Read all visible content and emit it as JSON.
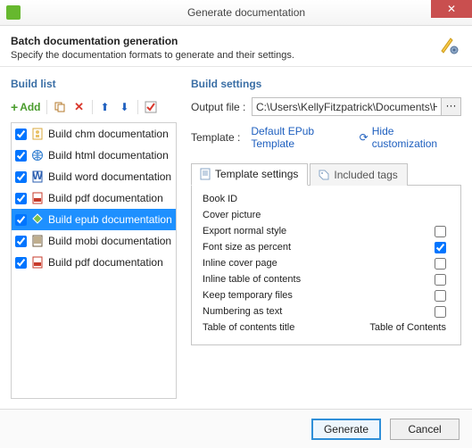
{
  "titlebar": {
    "title": "Generate documentation",
    "close_glyph": "✕"
  },
  "header": {
    "title": "Batch documentation generation",
    "subtitle": "Specify the documentation formats to generate and their settings."
  },
  "left": {
    "section": "Build list",
    "toolbar": {
      "add": "Add"
    },
    "items": [
      {
        "label": "Build chm documentation",
        "checked": true,
        "icon": "chm",
        "selected": false
      },
      {
        "label": "Build html documentation",
        "checked": true,
        "icon": "html",
        "selected": false
      },
      {
        "label": "Build word documentation",
        "checked": true,
        "icon": "word",
        "selected": false
      },
      {
        "label": "Build pdf documentation",
        "checked": true,
        "icon": "pdf",
        "selected": false
      },
      {
        "label": "Build epub documentation",
        "checked": true,
        "icon": "epub",
        "selected": true
      },
      {
        "label": "Build mobi documentation",
        "checked": true,
        "icon": "mobi",
        "selected": false
      },
      {
        "label": "Build pdf documentation",
        "checked": true,
        "icon": "pdf",
        "selected": false
      }
    ]
  },
  "right": {
    "section": "Build settings",
    "output_label": "Output file :",
    "output_value": "C:\\Users\\KellyFitzpatrick\\Documents\\HelpND",
    "template_label": "Template :",
    "template_value": "Default EPub Template",
    "hide_customization": "Hide customization",
    "tabs": {
      "template": "Template settings",
      "included": "Included tags"
    },
    "settings": [
      {
        "label": "Book ID",
        "checkbox": false,
        "checked": false,
        "value": ""
      },
      {
        "label": "Cover picture",
        "checkbox": false,
        "checked": false,
        "value": ""
      },
      {
        "label": "Export normal style",
        "checkbox": true,
        "checked": false,
        "value": ""
      },
      {
        "label": "Font size as percent",
        "checkbox": true,
        "checked": true,
        "value": ""
      },
      {
        "label": "Inline cover page",
        "checkbox": true,
        "checked": false,
        "value": ""
      },
      {
        "label": "Inline table of contents",
        "checkbox": true,
        "checked": false,
        "value": ""
      },
      {
        "label": "Keep temporary files",
        "checkbox": true,
        "checked": false,
        "value": ""
      },
      {
        "label": "Numbering as text",
        "checkbox": true,
        "checked": false,
        "value": ""
      },
      {
        "label": "Table of contents title",
        "checkbox": false,
        "checked": false,
        "value": "Table of Contents"
      }
    ]
  },
  "footer": {
    "generate": "Generate",
    "cancel": "Cancel"
  }
}
